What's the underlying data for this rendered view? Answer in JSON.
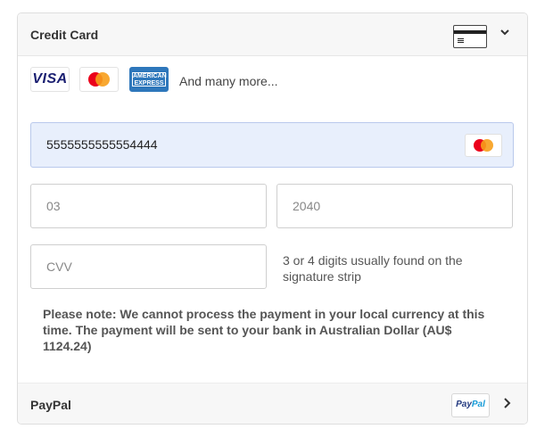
{
  "credit_card": {
    "title": "Credit Card",
    "card_icon": "credit-card-icon",
    "expand_icon": "chevron-down-icon",
    "logos": {
      "visa": "VISA",
      "mastercard": "mastercard-logo",
      "amex_line1": "AMERICAN",
      "amex_line2": "EXPRESS"
    },
    "more_text": "And many more...",
    "card_number": {
      "value": "5555555555554444",
      "brand_icon": "mastercard-logo"
    },
    "expiry_month": {
      "value": "03"
    },
    "expiry_year": {
      "value": "2040"
    },
    "cvv": {
      "placeholder": "CVV"
    },
    "cvv_help": "3 or 4 digits usually found on the signature strip",
    "note": "Please note: We cannot process the payment in your local currency at this time. The payment will be sent to your bank in Australian Dollar (AU$ 1124.24)"
  },
  "paypal": {
    "title": "PayPal",
    "logo_part1": "Pay",
    "logo_part2": "Pal",
    "expand_icon": "chevron-right-icon"
  },
  "colors": {
    "mc_red": "#eb001b",
    "mc_yellow": "#f79e1b",
    "amex_blue": "#2e77bb",
    "visa_blue": "#1a1f71",
    "number_field_bg": "#e8effc"
  }
}
